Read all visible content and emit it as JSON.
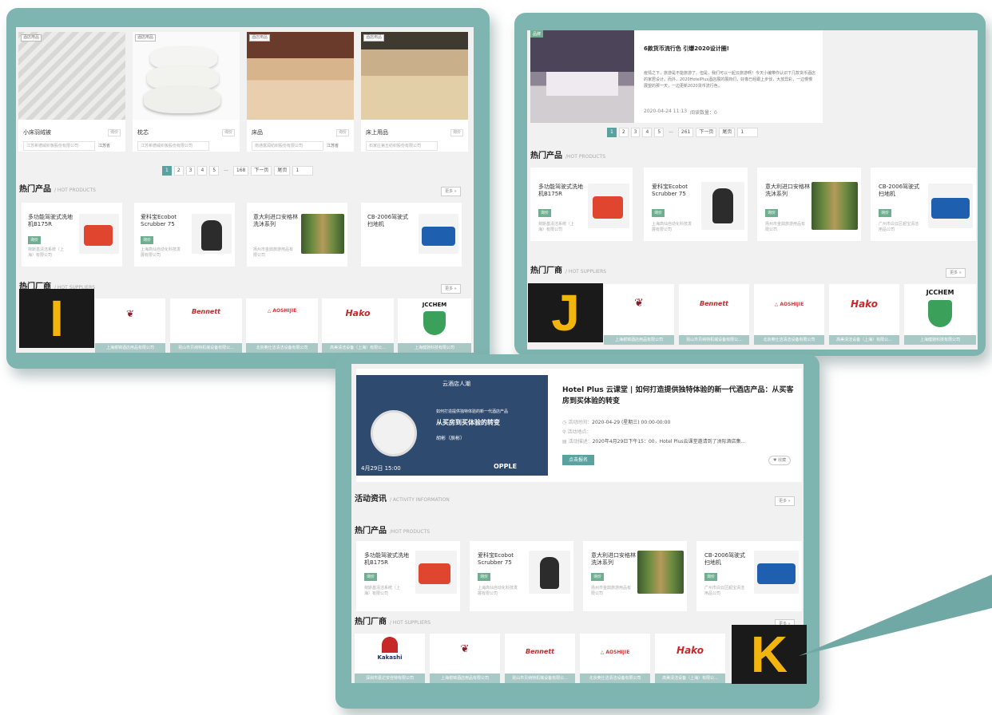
{
  "badges": {
    "i": "I",
    "j": "J",
    "k": "K"
  },
  "panel_i": {
    "products": [
      {
        "tag": "酒店用品",
        "name": "小床羽绒被",
        "btn": "询价",
        "addr": "江苏希德威织板股份有限公司",
        "loc": "江苏省"
      },
      {
        "tag": "酒店用品",
        "name": "枕芯",
        "btn": "询价",
        "addr": "江苏希德威织板股份有限公司",
        "loc": ""
      },
      {
        "tag": "酒店用品",
        "name": "床品",
        "btn": "询价",
        "addr": "南通富润纺织股份有限公司",
        "loc": "江苏省"
      },
      {
        "tag": "酒店用品",
        "name": "床上用品",
        "btn": "询价",
        "addr": "石家庄第五纺织股份有限公司",
        "loc": ""
      }
    ],
    "pagination": [
      "1",
      "2",
      "3",
      "4",
      "5",
      "...",
      "168",
      "下一页",
      "尾页",
      "1"
    ],
    "hot_products_title": "热门产品",
    "hot_products_en": "/ HOT PRODUCTS",
    "more": "更多 »",
    "hot_suppliers_title": "热门厂商",
    "hot_suppliers_en": "/ HOT SUPPLIERS",
    "suppliers": [
      "",
      "上海谢锦酒店用品有限公司",
      "昆山市贝纳特机械设备有限公...",
      "北京奥仕洁清洁设备有限公司",
      "高美清洁设备（上海）有限公...",
      "上海健驰科技有限公司"
    ]
  },
  "panel_j": {
    "news_tag": "品牌",
    "news_title": "6款货币流行色 引爆2020设计圈!",
    "news_body": "疫情之下，旅游是不能旅游了。但是，我们可以一起云旅游啊！今天小编带你认识下几款货币酒店的家居设计。而外，2020HotelPlus酒店展的展商们，好像已经跟上步伐，大放异彩，一边慢慢展望的那一天，一边更新2020货币流行色。",
    "news_time": "2020-04-24 11:13",
    "news_views": "阅读数量：0",
    "pagination": [
      "1",
      "2",
      "3",
      "4",
      "5",
      "...",
      "261",
      "下一页",
      "尾页",
      "1"
    ],
    "hot_products_title": "热门产品",
    "hot_products_en": "/HOT PRODUCTS",
    "hot_suppliers_title": "热门厂商",
    "hot_suppliers_en": "/ HOT SUPPLIERS",
    "more": "更多 »",
    "suppliers": [
      "",
      "上海谢锦酒店用品有限公司",
      "昆山市贝纳特机械设备有限公...",
      "北京奥仕洁清洁设备有限公司",
      "高美清洁设备（上海）有限公...",
      "上海健驰科技有限公司"
    ]
  },
  "panel_k": {
    "event_title": "Hotel Plus 云课堂 | 如何打造提供独特体验的新一代酒店产品：从买客房到买体验的转变",
    "event_time_label": "活动时间：",
    "event_time": "2020-04-29 (星期三) 00:00-00:00",
    "event_place_label": "活动地点：",
    "event_desc_label": "活动描述：",
    "event_desc": "2020年4月29日下午15：00，Hotel Plus云课堂邀请到了洲际酒店集...",
    "signup": "点击报名",
    "fav": "♥ 收藏",
    "poster_brand": "云酒店人潮",
    "poster_line1": "如何打造提供独特体验的新一代酒店产品",
    "poster_line2": "从买房到买体验的转变",
    "poster_name": "胡彬（辰彬）",
    "poster_date": "4月29日 15:00",
    "poster_sponsor": "OPPLE",
    "activity_title": "活动资讯",
    "activity_en": "/ ACTIVITY INFORMATION",
    "hot_products_title": "热门产品",
    "hot_products_en": "/HOT PRODUCTS",
    "hot_suppliers_title": "热门厂商",
    "hot_suppliers_en": "/ HOT SUPPLIERS",
    "more": "更多 »",
    "suppliers": [
      "深圳市嘉达安佳特有限公司",
      "上海谢锦酒店用品有限公司",
      "昆山市贝纳特机械设备有限公...",
      "北京奥仕洁清洁设备有限公司",
      "高美清洁设备（上海）有限公...",
      ""
    ]
  },
  "hot_products": [
    {
      "name": "多功能驾驶式洗地机B175R",
      "btn": "询价",
      "company": "荷斯基清洁系统（上海）有限公司"
    },
    {
      "name": "爱科宝Ecobot Scrubber 75",
      "btn": "询价",
      "company": "上海高仙自动化科技发展有限公司"
    },
    {
      "name": "意大利进口安格林洗沐系列",
      "btn": "询价",
      "company": "扬州市金鼎旅游用品有限公司"
    },
    {
      "name": "CB-2006驾驶式扫地机",
      "btn": "询价",
      "company": "广州市白云区超宝清洁用品公司"
    }
  ],
  "logos": {
    "bennett": "Bennett",
    "aosijie": "△ AOSHIJIE",
    "hako": "Hako",
    "jcchem": "JCCHEM",
    "kakashi": "Kakashi"
  }
}
